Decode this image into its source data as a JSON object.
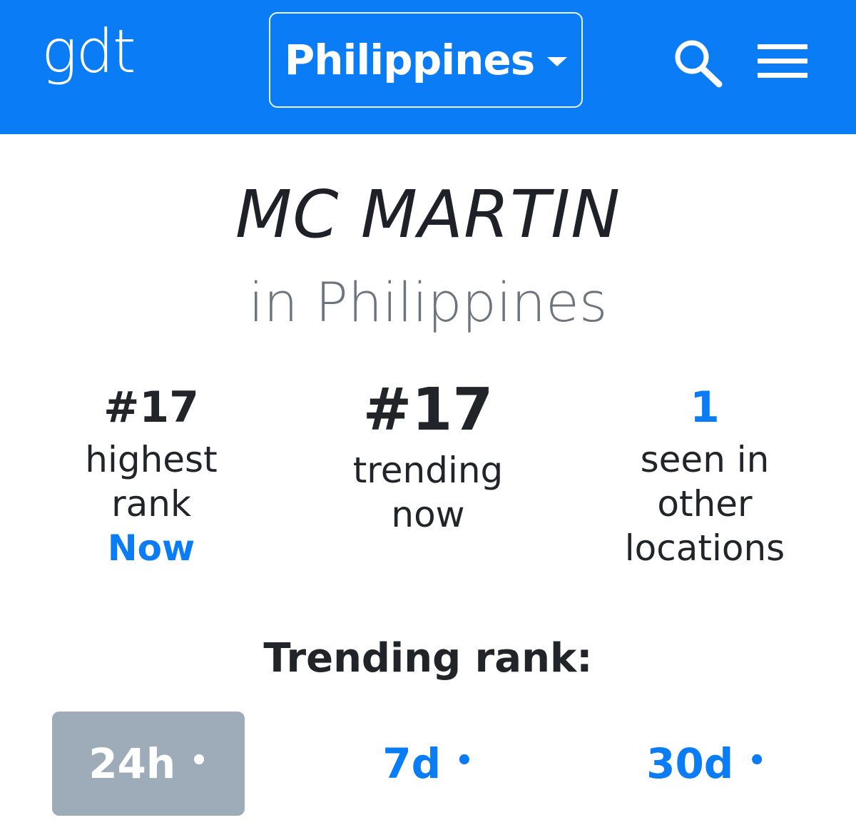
{
  "header": {
    "logo": "gdt",
    "country": "Philippines",
    "icons": [
      "search-icon",
      "hamburger-menu-icon"
    ],
    "accent_color": "#0a7cf5"
  },
  "title": {
    "name": "MC MARTIN",
    "location": "in Philippines"
  },
  "stats": {
    "highest": {
      "value": "#17",
      "label_line1": "highest",
      "label_line2": "rank",
      "when": "Now"
    },
    "trending": {
      "value": "#17",
      "label_line1": "trending",
      "label_line2": "now"
    },
    "other": {
      "value": "1",
      "label_line1": "seen in",
      "label_line2": "other",
      "label_line3": "locations"
    }
  },
  "trending_rank": {
    "heading": "Trending rank:",
    "tabs": [
      {
        "label": "24h",
        "active": true
      },
      {
        "label": "7d",
        "active": false
      },
      {
        "label": "30d",
        "active": false
      }
    ],
    "dot": "•"
  }
}
